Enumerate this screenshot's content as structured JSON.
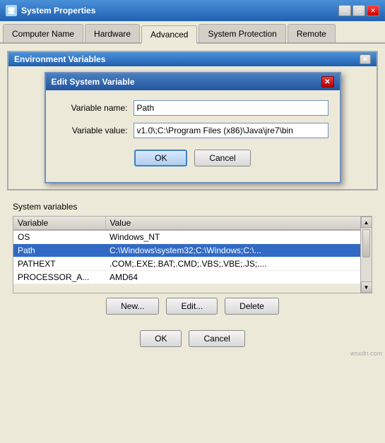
{
  "titleBar": {
    "title": "System Properties",
    "closeLabel": "✕",
    "minimizeLabel": "─",
    "maximizeLabel": "□"
  },
  "tabs": [
    {
      "id": "computer-name",
      "label": "Computer Name"
    },
    {
      "id": "hardware",
      "label": "Hardware"
    },
    {
      "id": "advanced",
      "label": "Advanced"
    },
    {
      "id": "system-protection",
      "label": "System Protection"
    },
    {
      "id": "remote",
      "label": "Remote"
    }
  ],
  "envPanel": {
    "title": "Environment Variables",
    "closeLabel": "✕"
  },
  "editDialog": {
    "title": "Edit System Variable",
    "closeLabel": "✕",
    "variableNameLabel": "Variable name:",
    "variableValueLabel": "Variable value:",
    "variableNameValue": "Path",
    "variableValueValue": "v1.0\\;C:\\Program Files (x86)\\Java\\jre7\\bin",
    "okLabel": "OK",
    "cancelLabel": "Cancel"
  },
  "systemVariables": {
    "sectionLabel": "System variables",
    "columns": [
      "Variable",
      "Value"
    ],
    "rows": [
      {
        "variable": "OS",
        "value": "Windows_NT",
        "selected": false
      },
      {
        "variable": "Path",
        "value": "C:\\Windows\\system32;C:\\Windows;C:\\...",
        "selected": true
      },
      {
        "variable": "PATHEXT",
        "value": ".COM;.EXE;.BAT;.CMD;.VBS;.VBE;.JS;....",
        "selected": false
      },
      {
        "variable": "PROCESSOR_A...",
        "value": "AMD64",
        "selected": false
      }
    ],
    "newLabel": "New...",
    "editLabel": "Edit...",
    "deleteLabel": "Delete"
  },
  "outerButtons": {
    "okLabel": "OK",
    "cancelLabel": "Cancel"
  },
  "watermark": "wsxdn.com"
}
